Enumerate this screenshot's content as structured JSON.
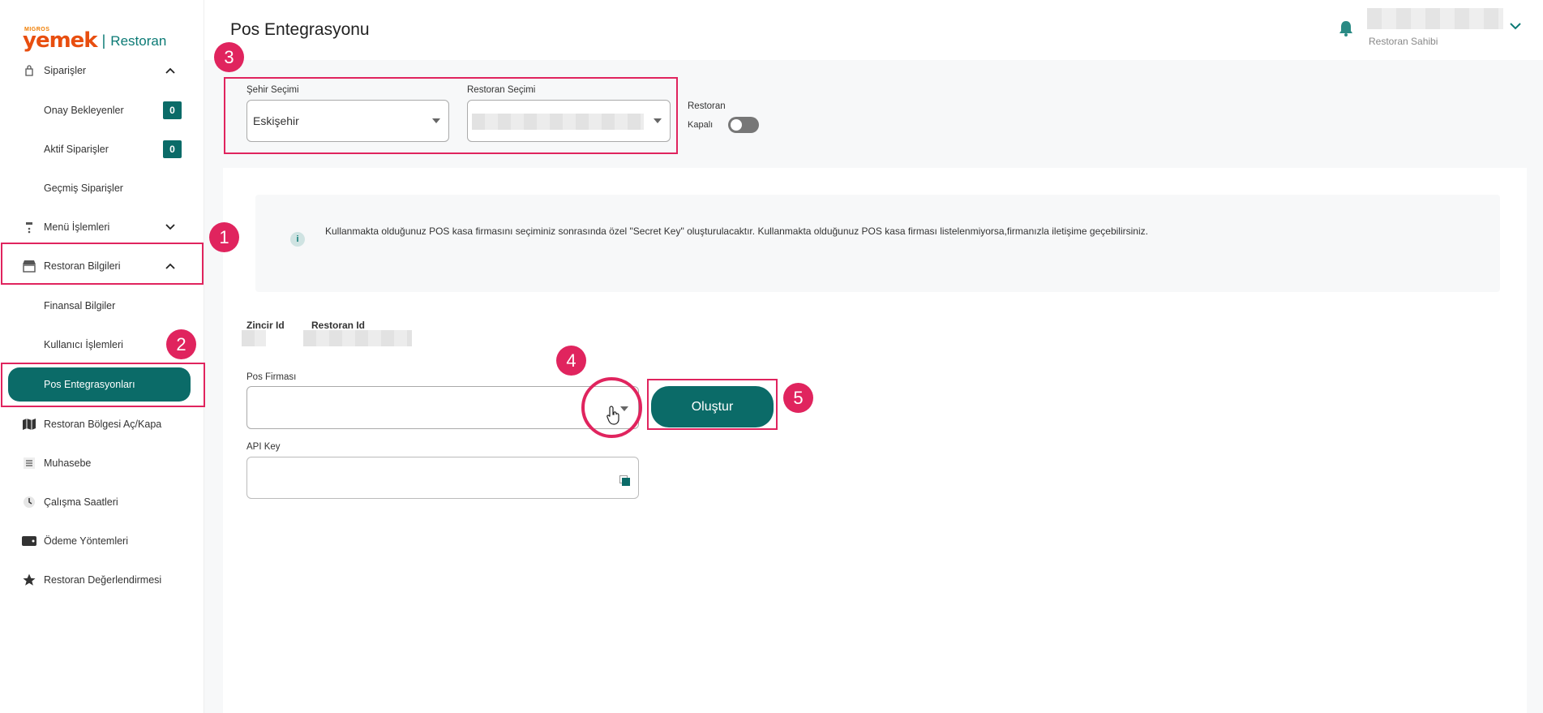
{
  "brand": {
    "migros": "MIGROS",
    "yemek": "yemek",
    "separator": "|",
    "restoran": "Restoran"
  },
  "sidebar": {
    "items": [
      {
        "label": "Siparişler",
        "icon": "bag-icon",
        "chevron": "⌃"
      },
      {
        "label": "Onay Bekleyenler",
        "badge": "0"
      },
      {
        "label": "Aktif Siparişler",
        "badge": "0"
      },
      {
        "label": "Geçmiş Siparişler"
      },
      {
        "label": "Menü İşlemleri",
        "icon": "menu-icon",
        "chevron": "⌄"
      },
      {
        "label": "Restoran Bilgileri",
        "icon": "store-icon",
        "chevron": "⌃"
      },
      {
        "label": "Finansal Bilgiler"
      },
      {
        "label": "Kullanıcı İşlemleri"
      },
      {
        "label": "Pos Entegrasyonları"
      },
      {
        "label": "Restoran Bölgesi Aç/Kapa",
        "icon": "map-icon"
      },
      {
        "label": "Muhasebe",
        "icon": "list-icon"
      },
      {
        "label": "Çalışma Saatleri",
        "icon": "clock-icon"
      },
      {
        "label": "Ödeme Yöntemleri",
        "icon": "wallet-icon"
      },
      {
        "label": "Restoran Değerlendirmesi",
        "icon": "star-icon"
      }
    ]
  },
  "header": {
    "title": "Pos Entegrasyonu",
    "user_role": "Restoran Sahibi"
  },
  "filters": {
    "city_label": "Şehir Seçimi",
    "city_value": "Eskişehir",
    "restaurant_label": "Restoran Seçimi",
    "toggle_label": "Restoran",
    "toggle_state": "Kapalı"
  },
  "info": {
    "icon": "i",
    "text": "Kullanmakta olduğunuz POS kasa firmasını seçiminiz sonrasında özel \"Secret Key\" oluşturulacaktır. Kullanmakta olduğunuz POS kasa firması listelenmiyorsa,firmanızla iletişime geçebilirsiniz."
  },
  "ids": {
    "chain_label": "Zincir Id",
    "restaurant_label": "Restoran Id"
  },
  "form": {
    "pos_label": "Pos Firması",
    "api_label": "API Key",
    "create_button": "Oluştur"
  },
  "annotations": {
    "n1": "1",
    "n2": "2",
    "n3": "3",
    "n4": "4",
    "n5": "5"
  },
  "colors": {
    "accent": "#0b6b68",
    "annotation": "#e0245e",
    "brand_orange": "#e84e0f"
  }
}
